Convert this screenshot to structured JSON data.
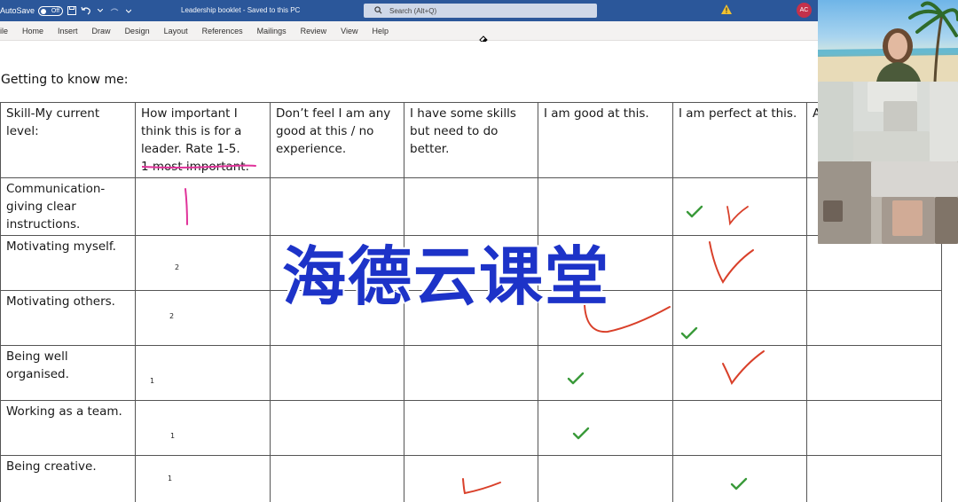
{
  "titlebar": {
    "autosave_label": "AutoSave",
    "autosave_state": "Off",
    "doc_title": "Leadership booklet  -  Saved to this PC",
    "search_placeholder": "Search (Alt+Q)",
    "user_initials": "AC"
  },
  "ribbon": {
    "tabs": [
      "ile",
      "Home",
      "Insert",
      "Draw",
      "Design",
      "Layout",
      "References",
      "Mailings",
      "Review",
      "View",
      "Help"
    ]
  },
  "document": {
    "heading": "Getting to know me:",
    "headers": [
      "Skill-My current level:",
      "How important I think this is for a leader. Rate 1-5.",
      "1 most important.",
      "Don’t feel I am any good at this / no experience.",
      "I have some skills but need to do better.",
      "I am good at this.",
      "I am perfect at this.",
      "A t"
    ],
    "rows": [
      {
        "skill": "Communication- giving clear instructions.",
        "rating": "1"
      },
      {
        "skill": "Motivating myself.",
        "rating": "2"
      },
      {
        "skill": "Motivating others.",
        "rating": "2"
      },
      {
        "skill": "Being well organised.",
        "rating": "1"
      },
      {
        "skill": "Working as a team.",
        "rating": "1"
      },
      {
        "skill": "Being creative.",
        "rating": "1"
      }
    ]
  },
  "watermark": "海德云课堂",
  "colors": {
    "word_blue": "#2b579a",
    "green_check": "#3a9a3a",
    "red_ink": "#d9402a",
    "pink_ink": "#e0339a",
    "watermark_blue": "#1d33c8"
  }
}
